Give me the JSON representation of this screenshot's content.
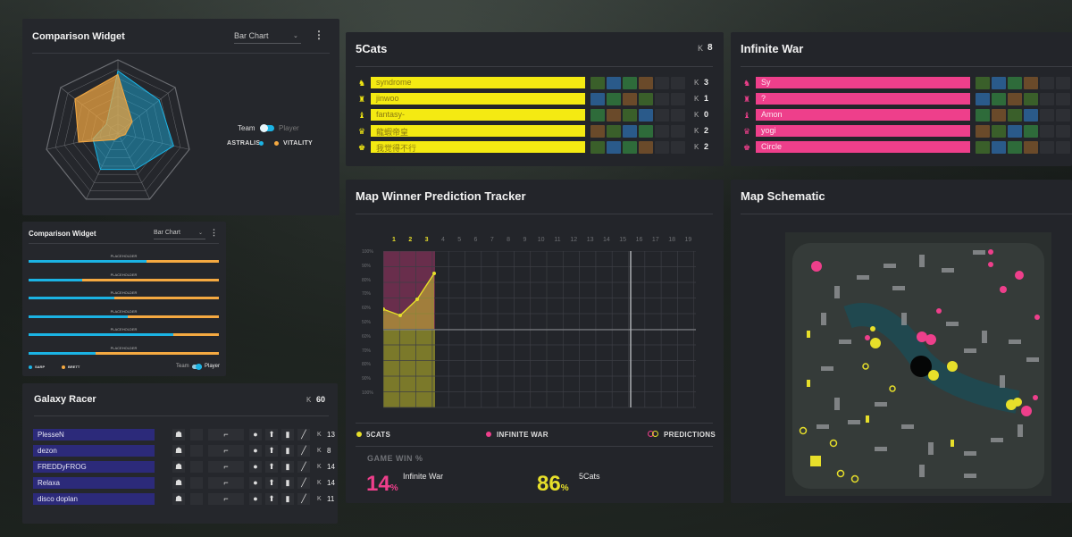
{
  "comparison_widget_1": {
    "title": "Comparison Widget",
    "select_value": "Bar Chart",
    "toggle_left": "Team",
    "toggle_right": "Player",
    "legend": [
      {
        "label": "ASTRALIS",
        "color": "#1bb3e4"
      },
      {
        "label": "VITALITY",
        "color": "#f5a941"
      }
    ]
  },
  "comparison_widget_2": {
    "title": "Comparison Widget",
    "select_value": "Bar Chart",
    "bars": [
      {
        "label": "PLACEHOLDER",
        "fill": 0.62
      },
      {
        "label": "PLACEHOLDER",
        "fill": 0.28
      },
      {
        "label": "PLACEHOLDER",
        "fill": 0.45
      },
      {
        "label": "PLACEHOLDER",
        "fill": 0.52
      },
      {
        "label": "PLACEHOLDER",
        "fill": 0.76
      },
      {
        "label": "PLACEHOLDER",
        "fill": 0.35
      }
    ],
    "legend": [
      {
        "label": "SARP",
        "color": "#1bb3e4"
      },
      {
        "label": "BRETT",
        "color": "#f5a941"
      }
    ],
    "toggle_left": "Team",
    "toggle_right": "Player"
  },
  "galaxy_racer": {
    "title": "Galaxy Racer",
    "k_label": "K",
    "k_value": "60",
    "players": [
      {
        "name": "PlesseN",
        "k": "13"
      },
      {
        "name": "dezon",
        "k": "8"
      },
      {
        "name": "FREDDyFROG",
        "k": "14"
      },
      {
        "name": "Relaxa",
        "k": "14"
      },
      {
        "name": "disco doplan",
        "k": "11"
      }
    ]
  },
  "team_5cats": {
    "title": "5Cats",
    "k_label": "K",
    "k_value": "8",
    "bar_color": "#f4ea12",
    "players": [
      {
        "name": "syndrome",
        "k": "3"
      },
      {
        "name": "jinwoo",
        "k": "1"
      },
      {
        "name": "fantasy-",
        "k": "0"
      },
      {
        "name": "龍蝦帝皇",
        "k": "2"
      },
      {
        "name": "我觉得不行",
        "k": "2"
      }
    ]
  },
  "team_infinite_war": {
    "title": "Infinite War",
    "bar_color": "#ee3f8b",
    "players": [
      {
        "name": "Sy"
      },
      {
        "name": "?"
      },
      {
        "name": "Amon"
      },
      {
        "name": "yogi"
      },
      {
        "name": "Circle"
      }
    ]
  },
  "prediction_tracker": {
    "title": "Map Winner Prediction Tracker",
    "rounds": [
      "1",
      "2",
      "3",
      "4",
      "5",
      "6",
      "7",
      "8",
      "9",
      "10",
      "11",
      "12",
      "13",
      "14",
      "15",
      "16",
      "17",
      "18",
      "19"
    ],
    "active_rounds": 3,
    "y_labels": [
      "100%",
      "90%",
      "80%",
      "70%",
      "60%",
      "50%",
      "60%",
      "70%",
      "80%",
      "90%",
      "100%"
    ],
    "legend": [
      {
        "label": "5CATS",
        "color": "#e7df2a"
      },
      {
        "label": "INFINITE WAR",
        "color": "#ee3f8b"
      },
      {
        "label": "PREDICTIONS",
        "color": "#e7df2a"
      }
    ],
    "game_win_title": "GAME WIN %",
    "iw_value": "14",
    "iw_pct": "%",
    "iw_team": "Infinite War",
    "cats_value": "86",
    "cats_pct": "%",
    "cats_team": "5Cats"
  },
  "map_schematic": {
    "title": "Map Schematic"
  }
}
